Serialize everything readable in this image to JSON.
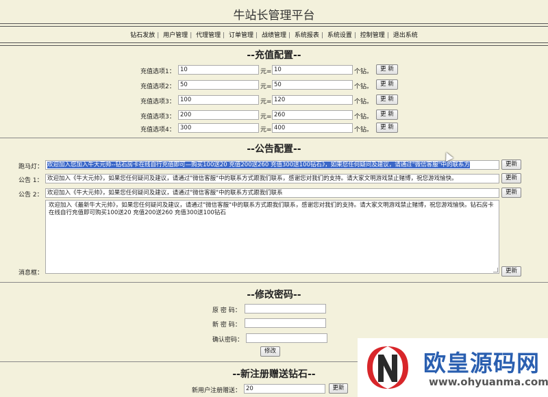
{
  "app_title": "牛站长管理平台",
  "nav": [
    "钻石发放",
    "用户管理",
    "代理管理",
    "订单管理",
    "战绩管理",
    "系统报表",
    "系统设置",
    "控制管理",
    "退出系统"
  ],
  "recharge": {
    "heading": "--充值配置--",
    "unit_yuan": "元=",
    "unit_diamond": "个钻。",
    "button": "更 新",
    "rows": [
      {
        "label": "充值选项1：",
        "yuan": "10",
        "diamonds": "10"
      },
      {
        "label": "充值选项2：",
        "yuan": "50",
        "diamonds": "50"
      },
      {
        "label": "充值选项3：",
        "yuan": "100",
        "diamonds": "120"
      },
      {
        "label": "充值选项3：",
        "yuan": "200",
        "diamonds": "260"
      },
      {
        "label": "充值选项4：",
        "yuan": "300",
        "diamonds": "400"
      }
    ]
  },
  "notice": {
    "heading": "--公告配置--",
    "button": "更新",
    "marquee_label": "跑马灯：",
    "marquee_value": "欢迎加入您加入牛大元帅--钻石房卡在线自行充值即可—购买100送20  充值200送260 充值300送100钻石》，如果您任何疑问及建议，请通过\"微信客服\"中的联系方",
    "notice1_label": "公告 1：",
    "notice1_value": "欢迎加入《牛大元帅》，如果您任何疑问及建议，请通过\"微信客服\"中的联系方式跟我们联系，感谢您对我们的支持。请大家文明游戏禁止赌博，祝您游戏愉快。",
    "notice2_label": "公告 2：",
    "notice2_value": "欢迎加入《牛大元帅》，如果您任何疑问及建议，请通过\"微信客服\"中的联系方式跟我们联系",
    "message_label": "消息框：",
    "message_value": "欢迎加入《最新牛大元帅》，如果您任何疑问及建议，请通过\"微信客服\"中的联系方式跟我们联系，感谢您对我们的支持。请大家文明游戏禁止赌博，祝您游戏愉快。钻石房卡在线自行充值即可购买100送20   充值200送260 充值300送100钻石"
  },
  "password": {
    "heading": "--修改密码--",
    "old_label": "原 密 码：",
    "new_label": "新 密 码：",
    "confirm_label": "确认密码：",
    "button": "修改"
  },
  "register_gift": {
    "heading": "--新注册赠送钻石--",
    "label": "新用户注册赠送：",
    "value": "20",
    "button": "更新"
  },
  "watermark": {
    "title": "欧皇源码网",
    "url": "www.ohyuanma.com",
    "colors": {
      "red": "#d8262a",
      "blue": "#2a5fb0"
    }
  }
}
